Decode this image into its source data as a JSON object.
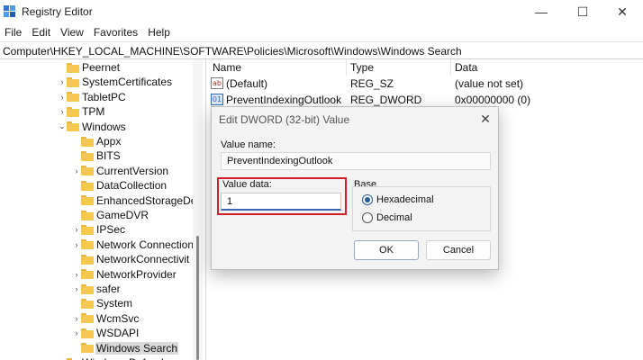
{
  "window": {
    "title": "Registry Editor",
    "minimize_glyph": "—",
    "maximize_glyph": "☐",
    "close_glyph": "✕"
  },
  "menu": [
    "File",
    "Edit",
    "View",
    "Favorites",
    "Help"
  ],
  "address": "Computer\\HKEY_LOCAL_MACHINE\\SOFTWARE\\Policies\\Microsoft\\Windows\\Windows Search",
  "tree": {
    "items": [
      {
        "label": "Peernet",
        "expander": "",
        "level": 1
      },
      {
        "label": "SystemCertificates",
        "expander": "›",
        "level": 1
      },
      {
        "label": "TabletPC",
        "expander": "›",
        "level": 1
      },
      {
        "label": "TPM",
        "expander": "›",
        "level": 1
      },
      {
        "label": "Windows",
        "expander": "⌄",
        "level": 1
      },
      {
        "label": "Appx",
        "expander": "",
        "level": 2
      },
      {
        "label": "BITS",
        "expander": "",
        "level": 2
      },
      {
        "label": "CurrentVersion",
        "expander": "›",
        "level": 2
      },
      {
        "label": "DataCollection",
        "expander": "",
        "level": 2
      },
      {
        "label": "EnhancedStorageDe",
        "expander": "",
        "level": 2
      },
      {
        "label": "GameDVR",
        "expander": "",
        "level": 2
      },
      {
        "label": "IPSec",
        "expander": "›",
        "level": 2
      },
      {
        "label": "Network Connection",
        "expander": "›",
        "level": 2
      },
      {
        "label": "NetworkConnectivit",
        "expander": "",
        "level": 2
      },
      {
        "label": "NetworkProvider",
        "expander": "›",
        "level": 2
      },
      {
        "label": "safer",
        "expander": "›",
        "level": 2
      },
      {
        "label": "System",
        "expander": "",
        "level": 2
      },
      {
        "label": "WcmSvc",
        "expander": "›",
        "level": 2
      },
      {
        "label": "WSDAPI",
        "expander": "›",
        "level": 2
      },
      {
        "label": "Windows Search",
        "expander": "",
        "level": 2,
        "selected": true
      },
      {
        "label": "Windows Defend",
        "expander": "›",
        "level": 1
      }
    ]
  },
  "list": {
    "columns": [
      "Name",
      "Type",
      "Data"
    ],
    "rows": [
      {
        "icon": "string-value-icon",
        "icon_glyph": "ab",
        "name": "(Default)",
        "type": "REG_SZ",
        "data": "(value not set)"
      },
      {
        "icon": "dword-value-icon",
        "icon_glyph": "01",
        "name": "PreventIndexingOutlook",
        "type": "REG_DWORD",
        "data": "0x00000000 (0)"
      }
    ]
  },
  "dialog": {
    "title": "Edit DWORD (32-bit) Value",
    "value_name_label": "Value name:",
    "value_name": "PreventIndexingOutlook",
    "value_data_label": "Value data:",
    "value_data": "1",
    "base_label": "Base",
    "base_options": [
      {
        "label": "Hexadecimal",
        "checked": true
      },
      {
        "label": "Decimal",
        "checked": false
      }
    ],
    "ok_label": "OK",
    "cancel_label": "Cancel",
    "highlight_color": "#d21e2b"
  }
}
